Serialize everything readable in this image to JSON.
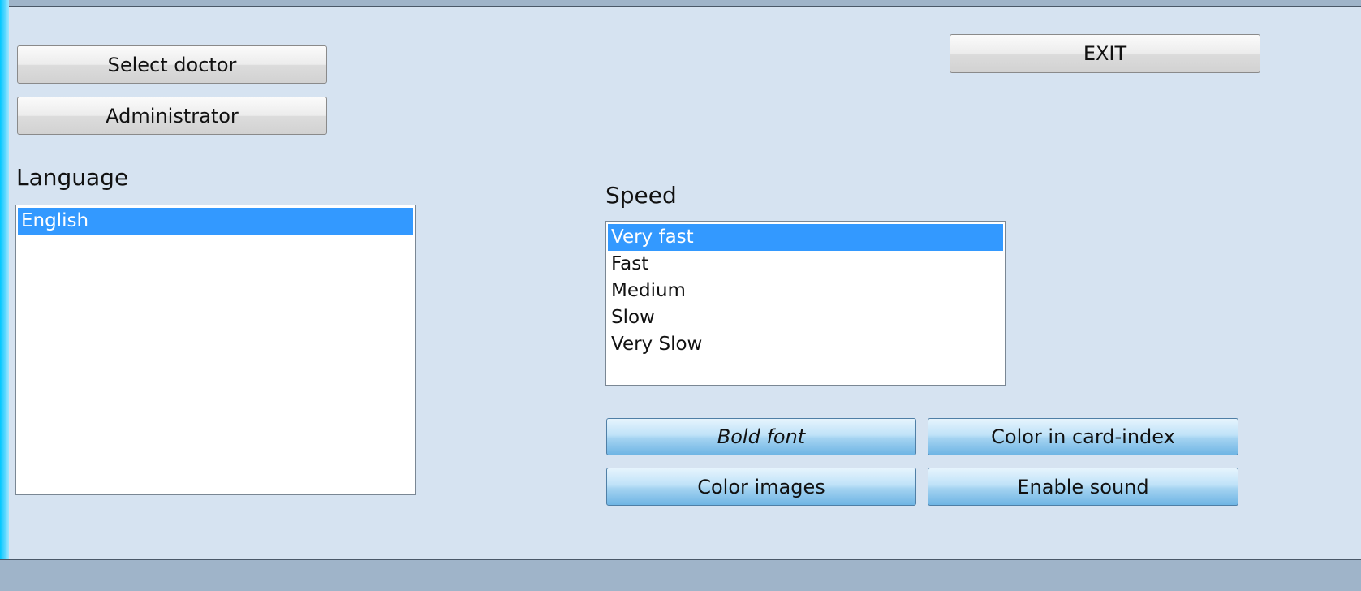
{
  "buttons": {
    "select_doctor": "Select doctor",
    "administrator": "Administrator",
    "exit": "EXIT",
    "bold_font": "Bold font",
    "color_in_card_index": "Color in card-index",
    "color_images": "Color images",
    "enable_sound": "Enable sound"
  },
  "language": {
    "label": "Language",
    "items": [
      "English"
    ],
    "selected": "English"
  },
  "speed": {
    "label": "Speed",
    "items": [
      "Very fast",
      "Fast",
      "Medium",
      "Slow",
      "Very Slow"
    ],
    "selected": "Very fast"
  },
  "colors": {
    "background": "#d6e3f1",
    "selection": "#3399ff",
    "bar": "#9fb4c9"
  }
}
